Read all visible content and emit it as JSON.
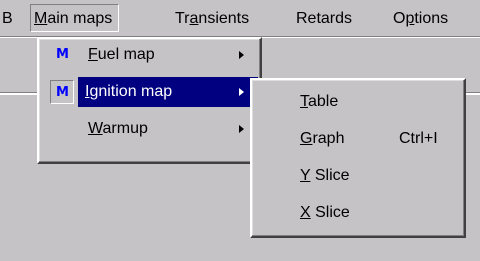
{
  "menubar": {
    "items": [
      {
        "prefix": "B",
        "underline": "",
        "rest": ""
      },
      {
        "prefix": "",
        "underline": "M",
        "rest": "ain maps"
      },
      {
        "prefix": "Tr",
        "underline": "a",
        "rest": "nsients"
      },
      {
        "prefix": "Retards",
        "underline": "",
        "rest": ""
      },
      {
        "prefix": "O",
        "underline": "p",
        "rest": "tions"
      }
    ]
  },
  "main_maps_menu": {
    "items": [
      {
        "icon": "M",
        "underline": "F",
        "rest": "uel map"
      },
      {
        "icon": "M",
        "underline": "I",
        "rest": "gnition map"
      },
      {
        "icon": "",
        "underline": "W",
        "rest": "armup"
      }
    ]
  },
  "ignition_submenu": {
    "items": [
      {
        "underline": "T",
        "rest": "able",
        "shortcut": ""
      },
      {
        "underline": "G",
        "rest": "raph",
        "shortcut": "Ctrl+I"
      },
      {
        "underline": "Y",
        "rest": " Slice",
        "shortcut": ""
      },
      {
        "underline": "X",
        "rest": " Slice",
        "shortcut": ""
      }
    ]
  },
  "colors": {
    "face": "#c6c3c6",
    "highlight": "#000080",
    "icon_blue": "#0000ff"
  }
}
